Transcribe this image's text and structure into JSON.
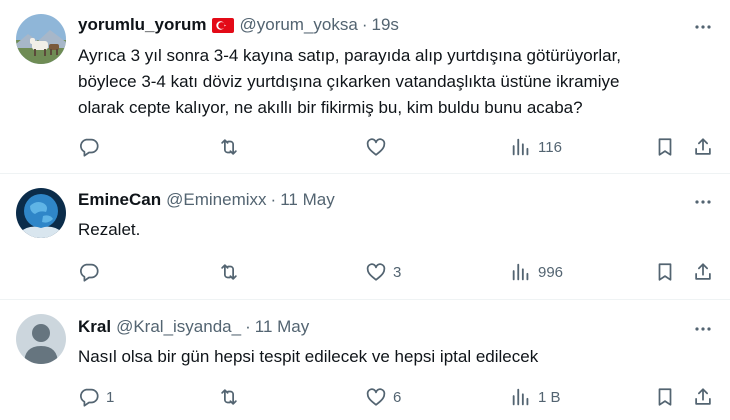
{
  "posts": [
    {
      "name": "yorumlu_yorum",
      "handle": "@yorum_yoksa",
      "time": "19s",
      "has_flag": true,
      "flag_colors": [
        "#e30a17",
        "#ffffff"
      ],
      "text_lines": [
        "Ayrıca 3 yıl sonra 3-4 kayına satıp, parayıda alıp yurtdışına götürüyorlar,",
        "böylece 3-4 katı döviz yurtdışına çıkarken vatandaşlıkta üstüne ikramiye",
        "olarak cepte kalıyor, ne akıllı bir fikirmiş bu, kim buldu bunu acaba?"
      ],
      "reply_count": "",
      "repost_count": "",
      "like_count": "",
      "view_count": "116"
    },
    {
      "name": "EmineCan",
      "handle": "@Eminemixx",
      "time": "11 May",
      "text_lines": [
        "Rezalet."
      ],
      "reply_count": "",
      "repost_count": "",
      "like_count": "3",
      "view_count": "996"
    },
    {
      "name": "Kral",
      "handle": "@Kral_isyanda_",
      "time": "11 May",
      "text_lines": [
        "Nasıl olsa bir gün hepsi tespit edilecek ve hepsi iptal edilecek"
      ],
      "reply_count": "1",
      "repost_count": "",
      "like_count": "6",
      "view_count": "1 B"
    }
  ],
  "icons": {
    "reply": "reply-icon",
    "repost": "repost-icon",
    "like": "like-icon",
    "views": "views-icon",
    "bookmark": "bookmark-icon",
    "share": "share-icon",
    "more": "more-icon"
  },
  "colors": {
    "text": "#0f1419",
    "secondary": "#536471",
    "divider": "#eff3f4",
    "default_avatar": "#ccd6dd"
  }
}
